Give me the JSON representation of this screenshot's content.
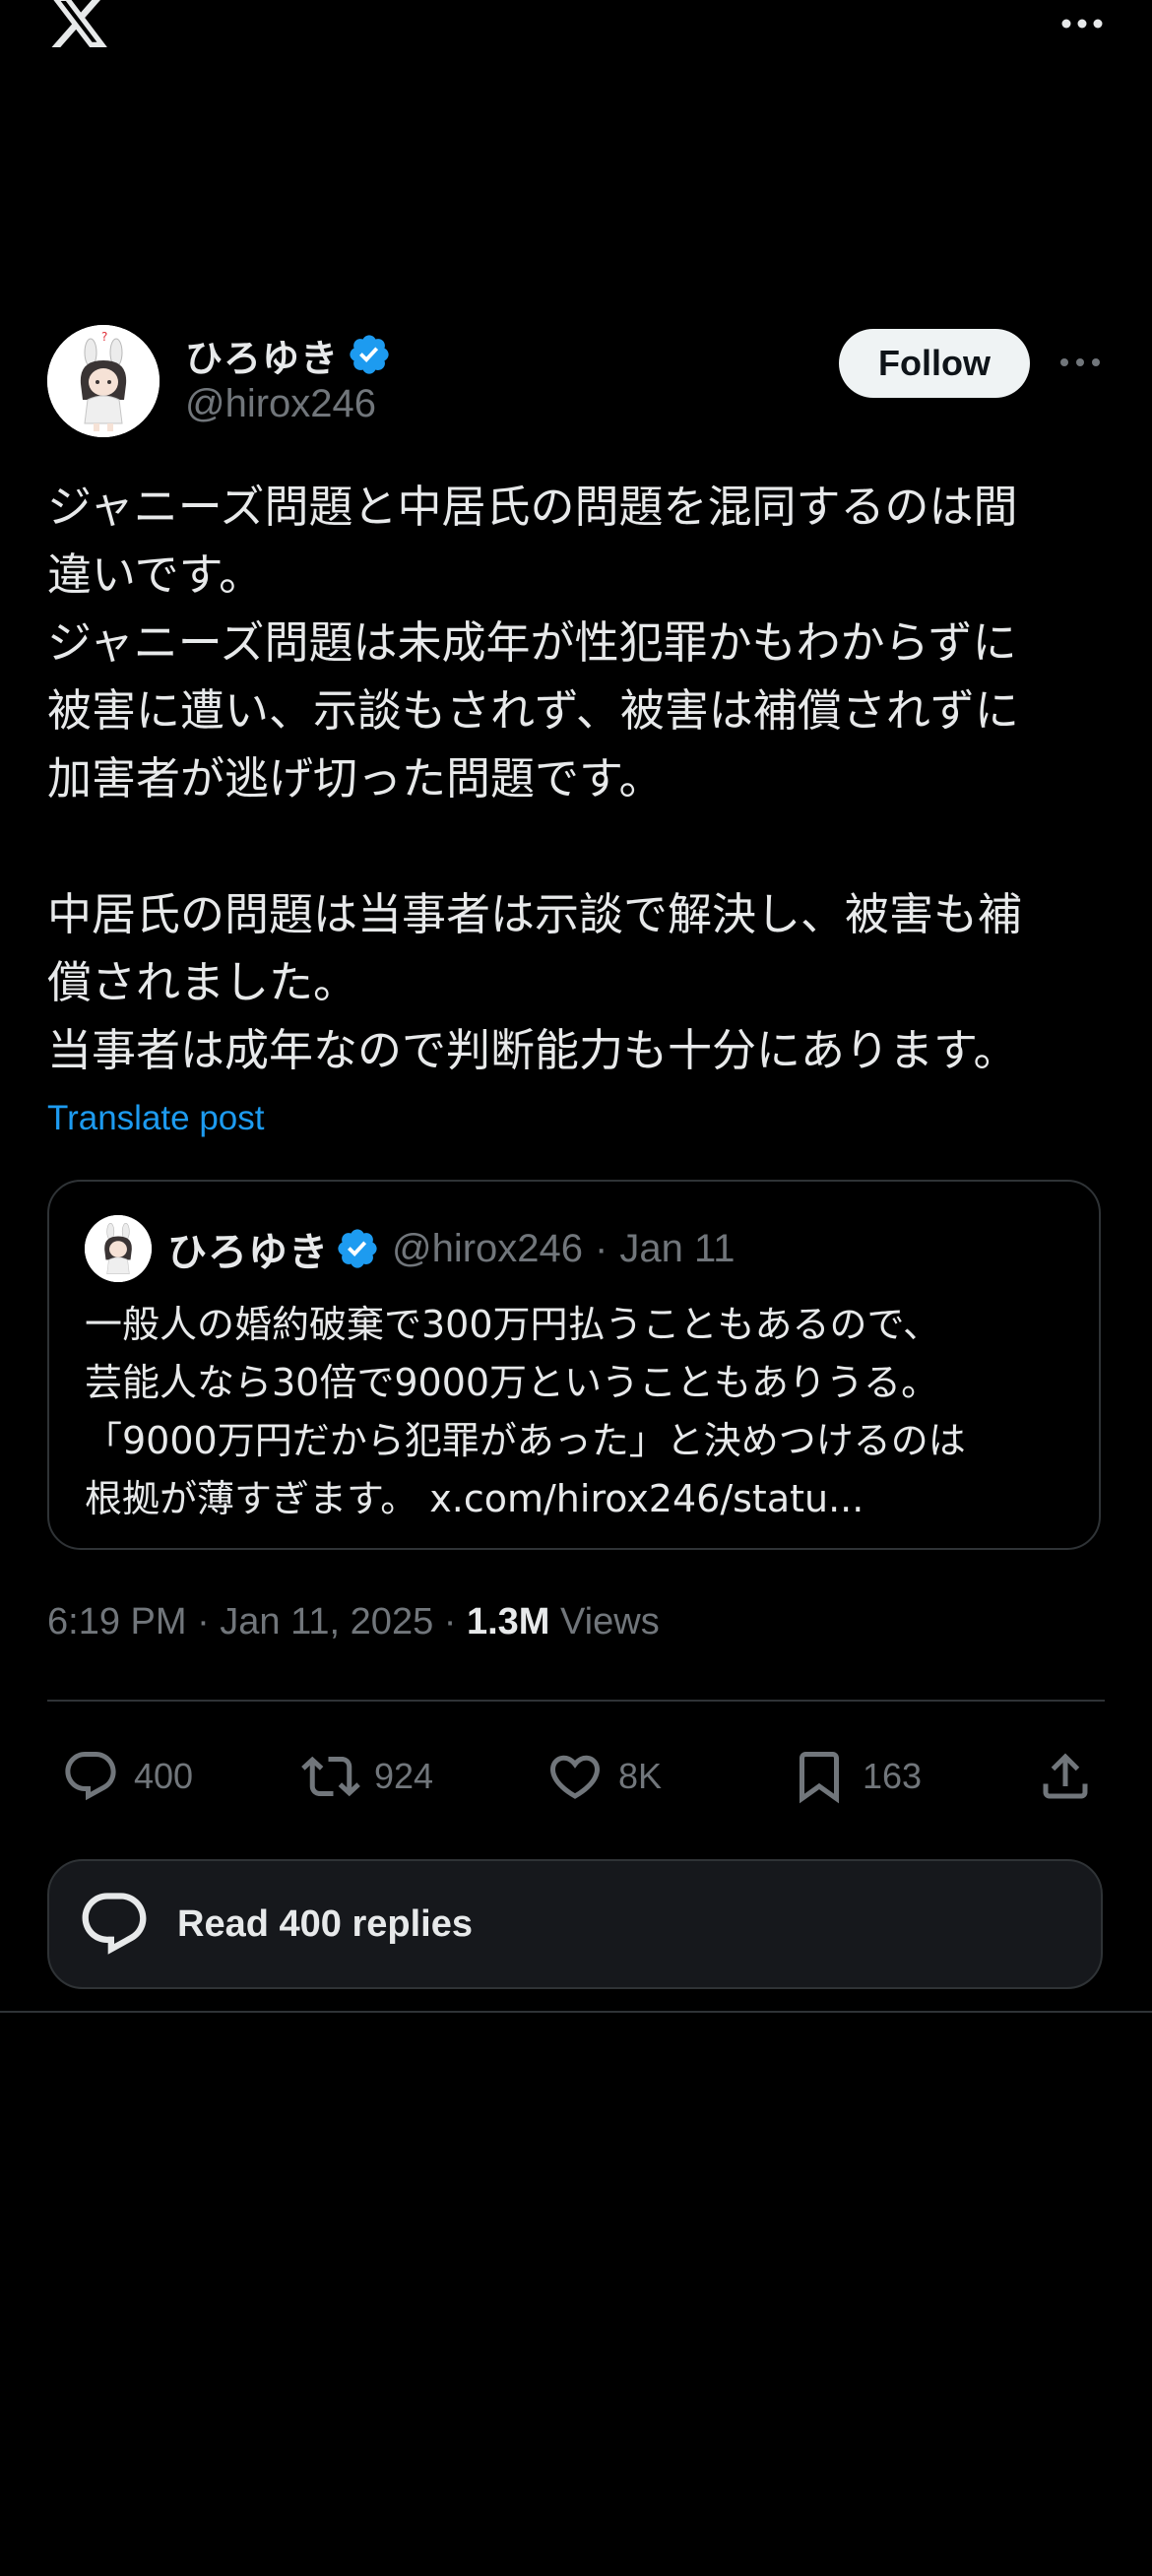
{
  "app": {
    "logo_icon": "x-logo-icon"
  },
  "author": {
    "display_name": "ひろゆき",
    "handle": "@hirox246",
    "verified": true
  },
  "follow_label": "Follow",
  "post": {
    "text": "ジャニーズ問題と中居氏の問題を混同するのは間\n違いです。\nジャニーズ問題は未成年が性犯罪かもわからずに\n被害に遭い、示談もされず、被害は補償されずに\n加害者が逃げ切った問題です。\n\n中居氏の問題は当事者は示談で解決し、被害も補\n償されました。\n当事者は成年なので判断能力も十分にあります。",
    "translate_label": "Translate post"
  },
  "quote": {
    "display_name": "ひろゆき",
    "handle": "@hirox246",
    "separator": "·",
    "date": "Jan 11",
    "text": "一般人の婚約破棄で300万円払うこともあるので、\n芸能人なら30倍で9000万ということもありうる。\n「9000万円だから犯罪があった」と決めつけるのは\n根拠が薄すぎます。 x.com/hirox246/statu..."
  },
  "meta": {
    "timestamp": "6:19 PM · Jan 11, 2025 · ",
    "views_count": "1.3M",
    "views_label": " Views"
  },
  "actions": {
    "replies": "400",
    "reposts": "924",
    "likes": "8K",
    "bookmarks": "163"
  },
  "read_replies_label": "Read 400 replies",
  "colors": {
    "background": "#000000",
    "text": "#e7e9ea",
    "secondary": "#71767b",
    "link": "#1d9bf0",
    "verified": "#1d9bf0",
    "border": "#2f3336"
  }
}
